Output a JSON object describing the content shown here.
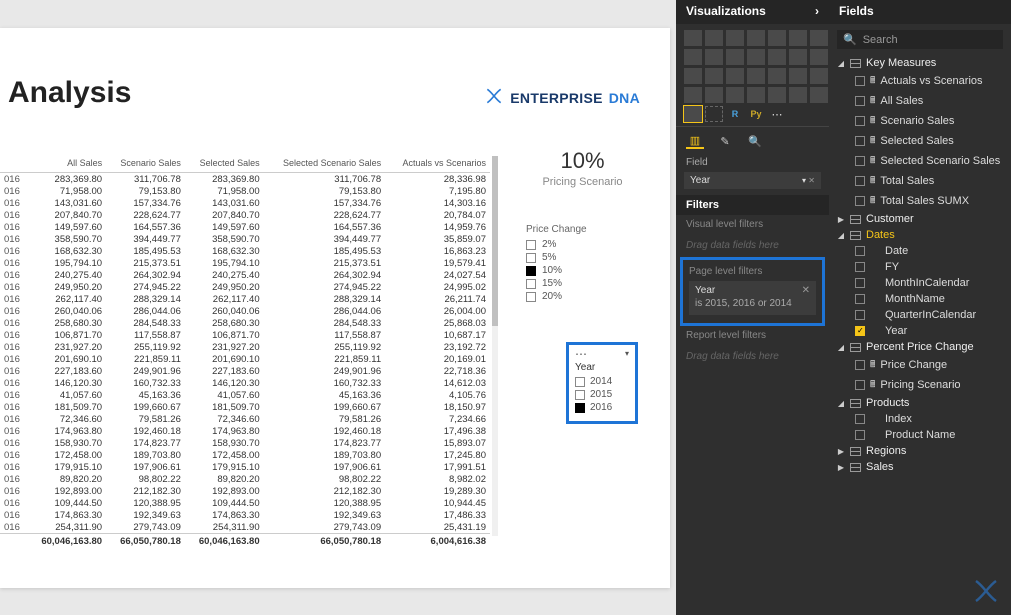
{
  "report": {
    "title": " Analysis",
    "brand1": "ENTERPRISE",
    "brand2": "DNA"
  },
  "scenario": {
    "value": "10%",
    "label": "Pricing Scenario"
  },
  "price_change": {
    "header": "Price Change",
    "options": [
      {
        "label": "2%",
        "on": false
      },
      {
        "label": "5%",
        "on": false
      },
      {
        "label": "10%",
        "on": true
      },
      {
        "label": "15%",
        "on": false
      },
      {
        "label": "20%",
        "on": false
      }
    ]
  },
  "year_slicer": {
    "header": "Year",
    "options": [
      {
        "label": "2014",
        "on": false
      },
      {
        "label": "2015",
        "on": false
      },
      {
        "label": "2016",
        "on": true
      }
    ]
  },
  "viz_pane": {
    "title": "Visualizations",
    "field_section": "Field",
    "field_value": "Year",
    "filters_title": "Filters",
    "visual_filters": "Visual level filters",
    "drag_hint": "Drag data fields here",
    "page_filters": "Page level filters",
    "page_filter_name": "Year",
    "page_filter_desc": "is 2015, 2016 or 2014",
    "report_filters": "Report level filters"
  },
  "fields_pane": {
    "title": "Fields",
    "search_placeholder": "Search",
    "groups": [
      {
        "name": "Key Measures",
        "open": true,
        "accent": false,
        "items": [
          {
            "label": "Actuals vs Scenarios",
            "checked": false,
            "calc": true
          },
          {
            "label": "All Sales",
            "checked": false,
            "calc": true
          },
          {
            "label": "Scenario Sales",
            "checked": false,
            "calc": true
          },
          {
            "label": "Selected Sales",
            "checked": false,
            "calc": true
          },
          {
            "label": "Selected Scenario Sales",
            "checked": false,
            "calc": true
          },
          {
            "label": "Total Sales",
            "checked": false,
            "calc": true
          },
          {
            "label": "Total Sales SUMX",
            "checked": false,
            "calc": true
          }
        ]
      },
      {
        "name": "Customer",
        "open": false,
        "accent": false,
        "items": []
      },
      {
        "name": "Dates",
        "open": true,
        "accent": true,
        "items": [
          {
            "label": "Date",
            "checked": false,
            "calc": false
          },
          {
            "label": "FY",
            "checked": false,
            "calc": false
          },
          {
            "label": "MonthInCalendar",
            "checked": false,
            "calc": false
          },
          {
            "label": "MonthName",
            "checked": false,
            "calc": false
          },
          {
            "label": "QuarterInCalendar",
            "checked": false,
            "calc": false
          },
          {
            "label": "Year",
            "checked": true,
            "calc": false
          }
        ]
      },
      {
        "name": "Percent Price Change",
        "open": true,
        "accent": false,
        "items": [
          {
            "label": "Price Change",
            "checked": false,
            "calc": true
          },
          {
            "label": "Pricing Scenario",
            "checked": false,
            "calc": true
          }
        ]
      },
      {
        "name": "Products",
        "open": true,
        "accent": false,
        "items": [
          {
            "label": "Index",
            "checked": false,
            "calc": false
          },
          {
            "label": "Product Name",
            "checked": false,
            "calc": false
          }
        ]
      },
      {
        "name": "Regions",
        "open": false,
        "accent": false,
        "items": []
      },
      {
        "name": "Sales",
        "open": false,
        "accent": false,
        "items": []
      }
    ]
  },
  "table": {
    "headers": [
      "",
      "All Sales",
      "Scenario Sales",
      "Selected Sales",
      "Selected Scenario Sales",
      "Actuals vs Scenarios"
    ],
    "rows": [
      [
        "016",
        "283,369.80",
        "311,706.78",
        "283,369.80",
        "311,706.78",
        "28,336.98"
      ],
      [
        "016",
        "71,958.00",
        "79,153.80",
        "71,958.00",
        "79,153.80",
        "7,195.80"
      ],
      [
        "016",
        "143,031.60",
        "157,334.76",
        "143,031.60",
        "157,334.76",
        "14,303.16"
      ],
      [
        "016",
        "207,840.70",
        "228,624.77",
        "207,840.70",
        "228,624.77",
        "20,784.07"
      ],
      [
        "016",
        "149,597.60",
        "164,557.36",
        "149,597.60",
        "164,557.36",
        "14,959.76"
      ],
      [
        "016",
        "358,590.70",
        "394,449.77",
        "358,590.70",
        "394,449.77",
        "35,859.07"
      ],
      [
        "016",
        "168,632.30",
        "185,495.53",
        "168,632.30",
        "185,495.53",
        "16,863.23"
      ],
      [
        "016",
        "195,794.10",
        "215,373.51",
        "195,794.10",
        "215,373.51",
        "19,579.41"
      ],
      [
        "016",
        "240,275.40",
        "264,302.94",
        "240,275.40",
        "264,302.94",
        "24,027.54"
      ],
      [
        "016",
        "249,950.20",
        "274,945.22",
        "249,950.20",
        "274,945.22",
        "24,995.02"
      ],
      [
        "016",
        "262,117.40",
        "288,329.14",
        "262,117.40",
        "288,329.14",
        "26,211.74"
      ],
      [
        "016",
        "260,040.06",
        "286,044.06",
        "260,040.06",
        "286,044.06",
        "26,004.00"
      ],
      [
        "016",
        "258,680.30",
        "284,548.33",
        "258,680.30",
        "284,548.33",
        "25,868.03"
      ],
      [
        "016",
        "106,871.70",
        "117,558.87",
        "106,871.70",
        "117,558.87",
        "10,687.17"
      ],
      [
        "016",
        "231,927.20",
        "255,119.92",
        "231,927.20",
        "255,119.92",
        "23,192.72"
      ],
      [
        "016",
        "201,690.10",
        "221,859.11",
        "201,690.10",
        "221,859.11",
        "20,169.01"
      ],
      [
        "016",
        "227,183.60",
        "249,901.96",
        "227,183.60",
        "249,901.96",
        "22,718.36"
      ],
      [
        "016",
        "146,120.30",
        "160,732.33",
        "146,120.30",
        "160,732.33",
        "14,612.03"
      ],
      [
        "016",
        "41,057.60",
        "45,163.36",
        "41,057.60",
        "45,163.36",
        "4,105.76"
      ],
      [
        "016",
        "181,509.70",
        "199,660.67",
        "181,509.70",
        "199,660.67",
        "18,150.97"
      ],
      [
        "016",
        "72,346.60",
        "79,581.26",
        "72,346.60",
        "79,581.26",
        "7,234.66"
      ],
      [
        "016",
        "174,963.80",
        "192,460.18",
        "174,963.80",
        "192,460.18",
        "17,496.38"
      ],
      [
        "016",
        "158,930.70",
        "174,823.77",
        "158,930.70",
        "174,823.77",
        "15,893.07"
      ],
      [
        "016",
        "172,458.00",
        "189,703.80",
        "172,458.00",
        "189,703.80",
        "17,245.80"
      ],
      [
        "016",
        "179,915.10",
        "197,906.61",
        "179,915.10",
        "197,906.61",
        "17,991.51"
      ],
      [
        "016",
        "89,820.20",
        "98,802.22",
        "89,820.20",
        "98,802.22",
        "8,982.02"
      ],
      [
        "016",
        "192,893.00",
        "212,182.30",
        "192,893.00",
        "212,182.30",
        "19,289.30"
      ],
      [
        "016",
        "109,444.50",
        "120,388.95",
        "109,444.50",
        "120,388.95",
        "10,944.45"
      ],
      [
        "016",
        "174,863.30",
        "192,349.63",
        "174,863.30",
        "192,349.63",
        "17,486.33"
      ],
      [
        "016",
        "254,311.90",
        "279,743.09",
        "254,311.90",
        "279,743.09",
        "25,431.19"
      ]
    ],
    "total": [
      "",
      "60,046,163.80",
      "66,050,780.18",
      "60,046,163.80",
      "66,050,780.18",
      "6,004,616.38"
    ]
  },
  "chart_data": {
    "type": "table",
    "title": "Analysis",
    "columns": [
      "All Sales",
      "Scenario Sales",
      "Selected Sales",
      "Selected Scenario Sales",
      "Actuals vs Scenarios"
    ],
    "year_suffix": "016",
    "rows": [
      [
        283369.8,
        311706.78,
        283369.8,
        311706.78,
        28336.98
      ],
      [
        71958.0,
        79153.8,
        71958.0,
        79153.8,
        7195.8
      ],
      [
        143031.6,
        157334.76,
        143031.6,
        157334.76,
        14303.16
      ],
      [
        207840.7,
        228624.77,
        207840.7,
        228624.77,
        20784.07
      ],
      [
        149597.6,
        164557.36,
        149597.6,
        164557.36,
        14959.76
      ],
      [
        358590.7,
        394449.77,
        358590.7,
        394449.77,
        35859.07
      ],
      [
        168632.3,
        185495.53,
        168632.3,
        185495.53,
        16863.23
      ],
      [
        195794.1,
        215373.51,
        195794.1,
        215373.51,
        19579.41
      ],
      [
        240275.4,
        264302.94,
        240275.4,
        264302.94,
        24027.54
      ],
      [
        249950.2,
        274945.22,
        249950.2,
        274945.22,
        24995.02
      ],
      [
        262117.4,
        288329.14,
        262117.4,
        288329.14,
        26211.74
      ],
      [
        260040.06,
        286044.06,
        260040.06,
        286044.06,
        26004.0
      ],
      [
        258680.3,
        284548.33,
        258680.3,
        284548.33,
        25868.03
      ],
      [
        106871.7,
        117558.87,
        106871.7,
        117558.87,
        10687.17
      ],
      [
        231927.2,
        255119.92,
        231927.2,
        255119.92,
        23192.72
      ],
      [
        201690.1,
        221859.11,
        201690.1,
        221859.11,
        20169.01
      ],
      [
        227183.6,
        249901.96,
        227183.6,
        249901.96,
        22718.36
      ],
      [
        146120.3,
        160732.33,
        146120.3,
        160732.33,
        14612.03
      ],
      [
        41057.6,
        45163.36,
        41057.6,
        45163.36,
        4105.76
      ],
      [
        181509.7,
        199660.67,
        181509.7,
        199660.67,
        18150.97
      ],
      [
        72346.6,
        79581.26,
        72346.6,
        79581.26,
        7234.66
      ],
      [
        174963.8,
        192460.18,
        174963.8,
        192460.18,
        17496.38
      ],
      [
        158930.7,
        174823.77,
        158930.7,
        174823.77,
        15893.07
      ],
      [
        172458.0,
        189703.8,
        172458.0,
        189703.8,
        17245.8
      ],
      [
        179915.1,
        197906.61,
        179915.1,
        197906.61,
        17991.51
      ],
      [
        89820.2,
        98802.22,
        89820.2,
        98802.22,
        8982.02
      ],
      [
        192893.0,
        212182.3,
        192893.0,
        212182.3,
        19289.3
      ],
      [
        109444.5,
        120388.95,
        109444.5,
        120388.95,
        10944.45
      ],
      [
        174863.3,
        192349.63,
        174863.3,
        192349.63,
        17486.33
      ],
      [
        254311.9,
        279743.09,
        254311.9,
        279743.09,
        25431.19
      ]
    ],
    "totals": [
      60046163.8,
      66050780.18,
      60046163.8,
      66050780.18,
      6004616.38
    ]
  }
}
